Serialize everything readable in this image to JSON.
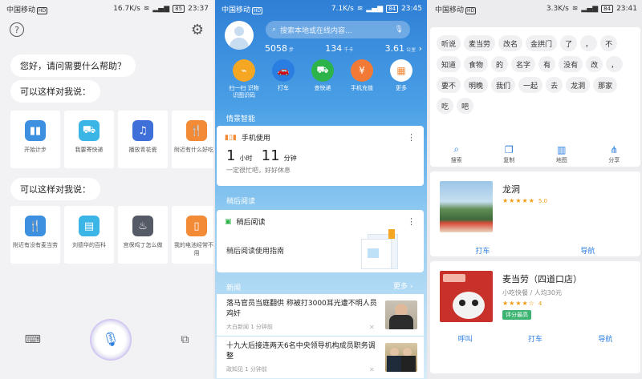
{
  "colors": {
    "accent": "#2a7de1",
    "star": "#f39c12",
    "badge": "#3cb371"
  },
  "p1": {
    "status": {
      "carrier": "中国移动",
      "hd": "HD",
      "speed": "16.7K/s",
      "battery": "85",
      "time": "23:37"
    },
    "greeting": "您好，请问需要什么帮助？",
    "hint1": "可以这样对我说：",
    "hint2": "可以这样对我说：",
    "row1": [
      {
        "label": "开始计步",
        "icon": "chart-icon",
        "glyph": "▮▮",
        "color": "#3d8fe0"
      },
      {
        "label": "我要寄快递",
        "icon": "truck-icon",
        "glyph": "⛟",
        "color": "#3bb4e6"
      },
      {
        "label": "播放青花瓷",
        "icon": "music-icon",
        "glyph": "♫",
        "color": "#3f6fd9"
      },
      {
        "label": "附近有什么好吃的",
        "icon": "food-icon",
        "glyph": "🍴",
        "color": "#f28a36"
      }
    ],
    "row2": [
      {
        "label": "附近有没有麦当劳",
        "icon": "restaurant-icon",
        "glyph": "🍴",
        "color": "#3d8fe0"
      },
      {
        "label": "刘德华的百科",
        "icon": "book-icon",
        "glyph": "▤",
        "color": "#3bb4e6"
      },
      {
        "label": "宫保鸡丁怎么做",
        "icon": "chef-hat-icon",
        "glyph": "♨",
        "color": "#555b66"
      },
      {
        "label": "我的电池经常不够用",
        "icon": "phone-icon",
        "glyph": "▯",
        "color": "#f28a36"
      }
    ],
    "help_glyph": "?",
    "gear_glyph": "⚙",
    "keyboard_glyph": "⌨",
    "mic_glyph": "🎙",
    "switch_glyph": "⧉"
  },
  "p2": {
    "status": {
      "carrier": "中国移动",
      "hd": "HD",
      "speed": "7.1K/s",
      "battery": "84",
      "time": "23:45"
    },
    "search_placeholder": "搜索本地或在线内容...",
    "search_glyph": "⌕",
    "mic_glyph": "🎙",
    "steps": "5058",
    "steps_unit": "步",
    "calories": "134",
    "calories_unit": "千卡",
    "distance": "3.61",
    "distance_unit": "公里",
    "arrow_glyph": "›",
    "apps": [
      {
        "label": "扫一扫 识物识图识码",
        "icon": "scan-icon",
        "glyph": "⌁",
        "color": "#f5a623"
      },
      {
        "label": "打车",
        "icon": "taxi-icon",
        "glyph": "🚗",
        "color": "#2a7de1"
      },
      {
        "label": "查快递",
        "icon": "truck-icon",
        "glyph": "⛟",
        "color": "#2cb34a"
      },
      {
        "label": "手机充值",
        "icon": "recharge-icon",
        "glyph": "¥",
        "color": "#f27a36"
      },
      {
        "label": "更多",
        "icon": "more-apps-icon",
        "glyph": "▦",
        "color": "#ffffff"
      }
    ],
    "scene_title": "情景智能",
    "usage_title": "手机使用",
    "usage_hours": "1",
    "usage_hours_unit": "小时",
    "usage_minutes": "11",
    "usage_minutes_unit": "分钟",
    "usage_note": "一定很忙吧，好好休息",
    "later_title": "稍后阅读",
    "later_card_title": "稍后阅读",
    "later_item": "稍后阅读使用指南",
    "news_title": "新闻",
    "news_more": "更多",
    "news": [
      {
        "title": "落马官员当庭翻供 称被打3000耳光遭不明人员鸡奸",
        "meta": "大白新闻 1 分钟前",
        "close": "✕"
      },
      {
        "title": "十九大后接连两天6名中央领导机构成员职务调整",
        "meta": "政知见 1 分钟前",
        "close": "✕"
      }
    ]
  },
  "p3": {
    "status": {
      "carrier": "中国移动",
      "hd": "HD",
      "speed": "3.3K/s",
      "battery": "84",
      "time": "23:41"
    },
    "words": [
      "听说",
      "麦当劳",
      "改名",
      "金拱门",
      "了",
      "，",
      "不",
      "知道",
      "食物",
      "的",
      "名字",
      "有",
      "没有",
      "改",
      "，",
      "要不",
      "明晚",
      "我们",
      "一起",
      "去",
      "龙洞",
      "那家",
      "吃",
      "吧"
    ],
    "tools": [
      {
        "label": "搜索",
        "icon": "search-icon",
        "glyph": "⌕"
      },
      {
        "label": "复制",
        "icon": "copy-icon",
        "glyph": "❐"
      },
      {
        "label": "地图",
        "icon": "map-icon",
        "glyph": "▥"
      },
      {
        "label": "分享",
        "icon": "share-icon",
        "glyph": "⋔"
      }
    ],
    "place1": {
      "name": "龙洞",
      "stars": "★★★★★",
      "score": "5.0",
      "actions": [
        "打车",
        "导航"
      ]
    },
    "place2": {
      "name": "麦当劳（四道口店）",
      "info": "小吃快餐 / 人均30元",
      "stars": "★★★★☆",
      "score": "4",
      "badge": "评分最高",
      "actions": [
        "呼叫",
        "打车",
        "导航"
      ]
    }
  }
}
